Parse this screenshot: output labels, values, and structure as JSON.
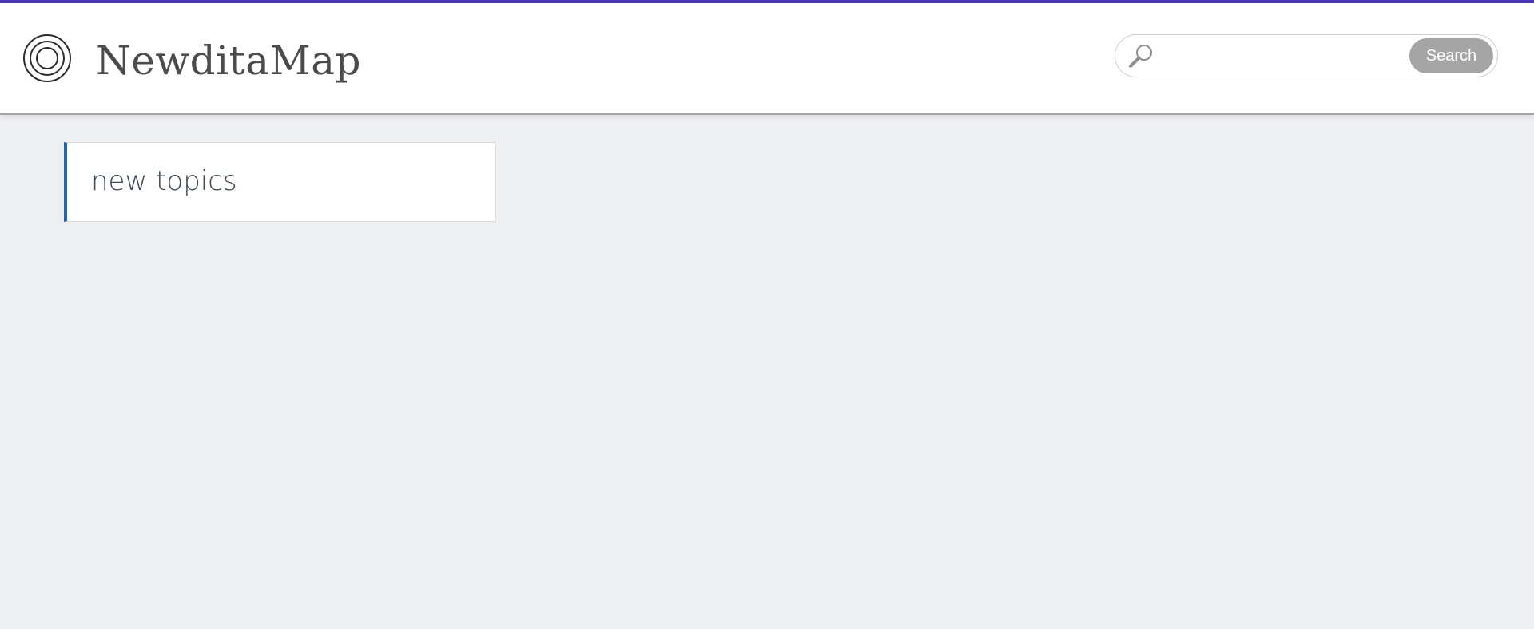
{
  "header": {
    "logo_icon": "concentric-circles-logo-icon",
    "site_title": "NewditaMap",
    "accent_color": "#4a36b4"
  },
  "search": {
    "icon": "search-icon",
    "placeholder": "",
    "value": "",
    "button_label": "Search"
  },
  "main": {
    "cards": [
      {
        "label": "new topics",
        "accent_color": "#1f63b5"
      }
    ]
  }
}
